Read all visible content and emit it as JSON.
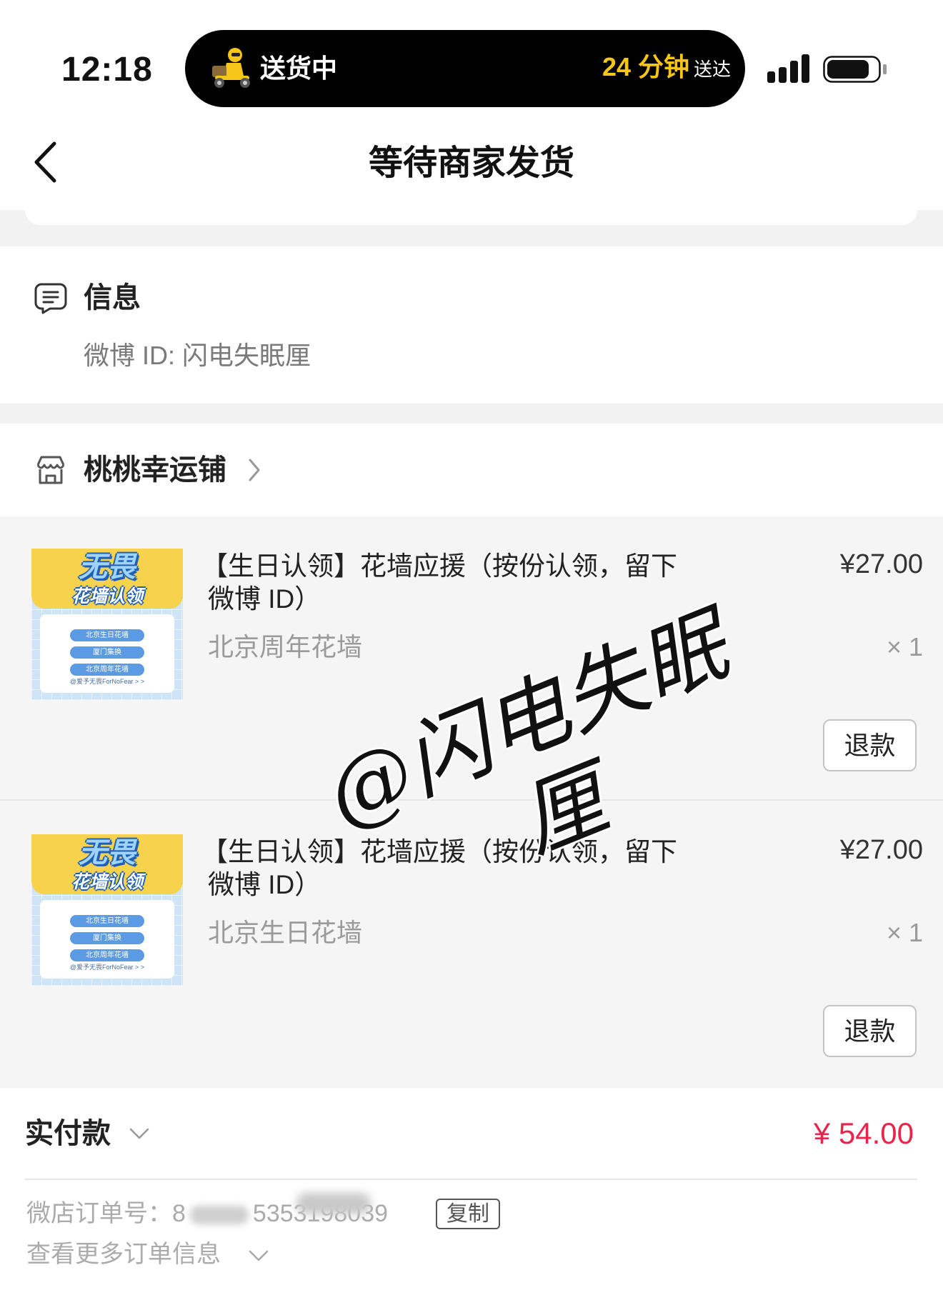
{
  "status_bar": {
    "time": "12:18",
    "activity_label": "送货中",
    "eta_value": "24 分钟",
    "eta_suffix": "送达"
  },
  "nav": {
    "title": "等待商家发货"
  },
  "info": {
    "heading": "信息",
    "weibo_line": "微博 ID: 闪电失眠厘"
  },
  "shop": {
    "name": "桃桃幸运铺"
  },
  "items": [
    {
      "title_line1": "【生日认领】花墙应援（按份认领，留下",
      "title_line2": "微博 ID）",
      "variant": "北京周年花墙",
      "price": "¥27.00",
      "quantity": "× 1",
      "refund_label": "退款"
    },
    {
      "title_line1": "【生日认领】花墙应援（按份认领，留下",
      "title_line2": "微博 ID）",
      "variant": "北京生日花墙",
      "price": "¥27.00",
      "quantity": "× 1",
      "refund_label": "退款"
    }
  ],
  "thumbnail": {
    "brand": "无畏",
    "tagline": "花墙认领",
    "pills": [
      "北京生日花墙",
      "厦门集换",
      "北京周年花墙"
    ],
    "footer": "@爱予无畏ForNoFear  > >"
  },
  "watermark": {
    "text": "@闪电失眠厘"
  },
  "payment": {
    "label": "实付款",
    "amount": "¥ 54.00"
  },
  "order": {
    "label": "微店订单号：",
    "number_start": "8",
    "number_end": "5353198039",
    "copy_label": "复制",
    "more_label": "查看更多订单信息"
  },
  "icons": {
    "delivery": "delivery-scooter-icon",
    "signal": "signal-icon",
    "battery": "battery-icon",
    "back": "back-chevron-icon",
    "info": "info-note-icon",
    "store": "store-icon",
    "shop_chevron": "chevron-right-icon",
    "expand": "chevron-down-icon"
  },
  "colors": {
    "price_red": "#e8264c",
    "eta_yellow": "#f5c518",
    "island_bg": "#000000",
    "item_bg": "#f5f5f5",
    "thumbnail_yellow": "#f7d24c",
    "thumbnail_blue": "#5b9be3"
  }
}
